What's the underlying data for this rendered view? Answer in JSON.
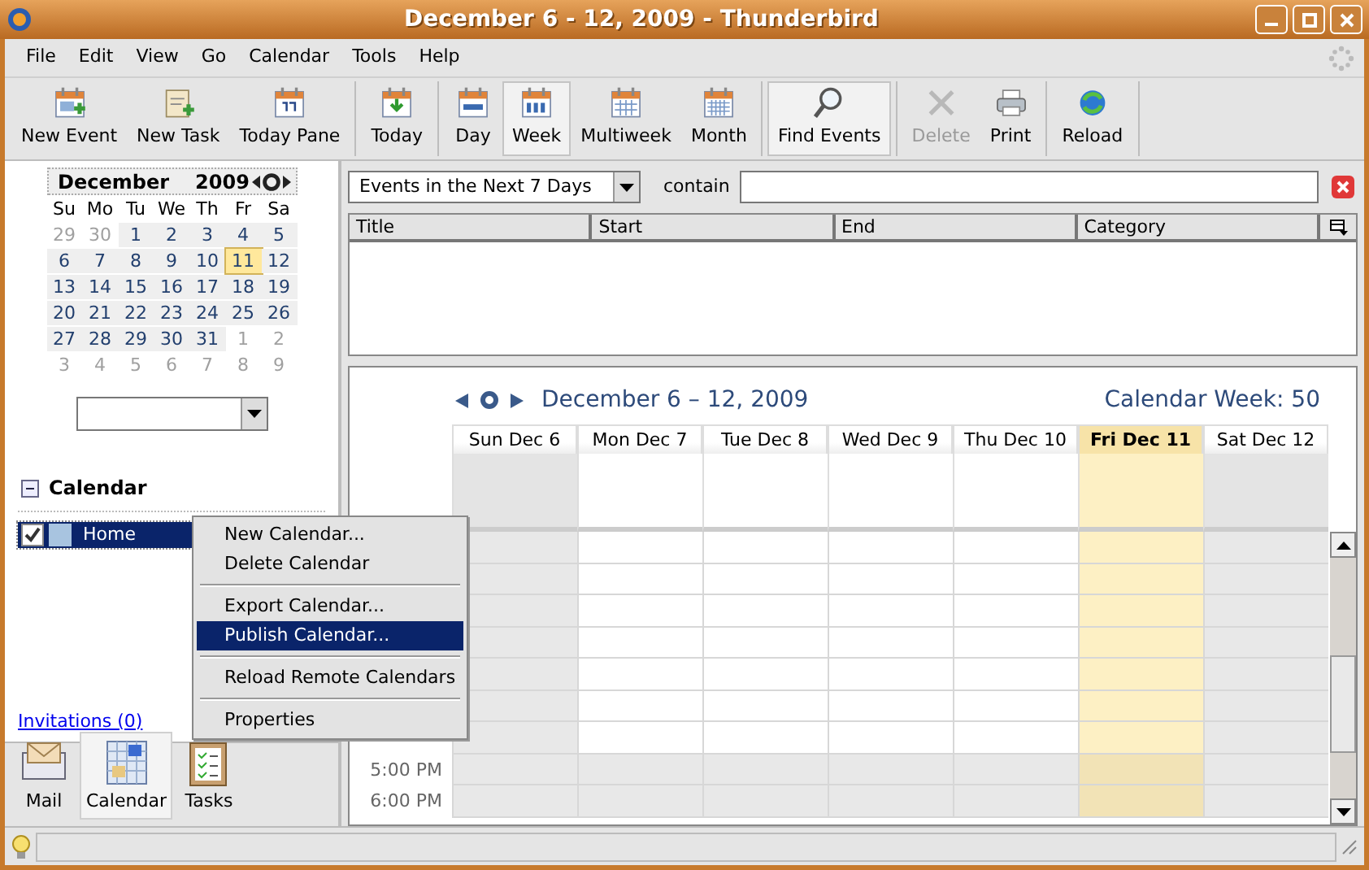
{
  "window": {
    "title": "December 6 - 12, 2009 - Thunderbird"
  },
  "menu_bar": [
    "File",
    "Edit",
    "View",
    "Go",
    "Calendar",
    "Tools",
    "Help"
  ],
  "toolbar": [
    [
      {
        "label": "New Event",
        "selected": false,
        "disabled": false
      },
      {
        "label": "New Task",
        "selected": false,
        "disabled": false
      },
      {
        "label": "Today Pane",
        "selected": false,
        "disabled": false
      }
    ],
    [
      {
        "label": "Today",
        "selected": false,
        "disabled": false
      }
    ],
    [
      {
        "label": "Day",
        "selected": false,
        "disabled": false
      },
      {
        "label": "Week",
        "selected": true,
        "disabled": false
      },
      {
        "label": "Multiweek",
        "selected": false,
        "disabled": false
      },
      {
        "label": "Month",
        "selected": false,
        "disabled": false
      }
    ],
    [
      {
        "label": "Find Events",
        "selected": true,
        "disabled": false
      }
    ],
    [
      {
        "label": "Delete",
        "selected": false,
        "disabled": true
      },
      {
        "label": "Print",
        "selected": false,
        "disabled": false
      }
    ],
    [
      {
        "label": "Reload",
        "selected": false,
        "disabled": false
      }
    ]
  ],
  "mini_month": {
    "month": "December",
    "year": "2009",
    "day_names": [
      "Su",
      "Mo",
      "Tu",
      "We",
      "Th",
      "Fr",
      "Sa"
    ],
    "weeks": [
      [
        {
          "day": "29",
          "other_month": true,
          "selected": false
        },
        {
          "day": "30",
          "other_month": true,
          "selected": false
        },
        {
          "day": "1",
          "other_month": false,
          "selected": false
        },
        {
          "day": "2",
          "other_month": false,
          "selected": false
        },
        {
          "day": "3",
          "other_month": false,
          "selected": false
        },
        {
          "day": "4",
          "other_month": false,
          "selected": false
        },
        {
          "day": "5",
          "other_month": false,
          "selected": false
        }
      ],
      [
        {
          "day": "6",
          "other_month": false,
          "selected": false
        },
        {
          "day": "7",
          "other_month": false,
          "selected": false
        },
        {
          "day": "8",
          "other_month": false,
          "selected": false
        },
        {
          "day": "9",
          "other_month": false,
          "selected": false
        },
        {
          "day": "10",
          "other_month": false,
          "selected": false
        },
        {
          "day": "11",
          "other_month": false,
          "selected": true
        },
        {
          "day": "12",
          "other_month": false,
          "selected": false
        }
      ],
      [
        {
          "day": "13",
          "other_month": false,
          "selected": false
        },
        {
          "day": "14",
          "other_month": false,
          "selected": false
        },
        {
          "day": "15",
          "other_month": false,
          "selected": false
        },
        {
          "day": "16",
          "other_month": false,
          "selected": false
        },
        {
          "day": "17",
          "other_month": false,
          "selected": false
        },
        {
          "day": "18",
          "other_month": false,
          "selected": false
        },
        {
          "day": "19",
          "other_month": false,
          "selected": false
        }
      ],
      [
        {
          "day": "20",
          "other_month": false,
          "selected": false
        },
        {
          "day": "21",
          "other_month": false,
          "selected": false
        },
        {
          "day": "22",
          "other_month": false,
          "selected": false
        },
        {
          "day": "23",
          "other_month": false,
          "selected": false
        },
        {
          "day": "24",
          "other_month": false,
          "selected": false
        },
        {
          "day": "25",
          "other_month": false,
          "selected": false
        },
        {
          "day": "26",
          "other_month": false,
          "selected": false
        }
      ],
      [
        {
          "day": "27",
          "other_month": false,
          "selected": false
        },
        {
          "day": "28",
          "other_month": false,
          "selected": false
        },
        {
          "day": "29",
          "other_month": false,
          "selected": false
        },
        {
          "day": "30",
          "other_month": false,
          "selected": false
        },
        {
          "day": "31",
          "other_month": false,
          "selected": false
        },
        {
          "day": "1",
          "other_month": true,
          "selected": false
        },
        {
          "day": "2",
          "other_month": true,
          "selected": false
        }
      ],
      [
        {
          "day": "3",
          "other_month": true,
          "selected": false
        },
        {
          "day": "4",
          "other_month": true,
          "selected": false
        },
        {
          "day": "5",
          "other_month": true,
          "selected": false
        },
        {
          "day": "6",
          "other_month": true,
          "selected": false
        },
        {
          "day": "7",
          "other_month": true,
          "selected": false
        },
        {
          "day": "8",
          "other_month": true,
          "selected": false
        },
        {
          "day": "9",
          "other_month": true,
          "selected": false
        }
      ]
    ]
  },
  "calendar_section": {
    "title": "Calendar",
    "expanded": true,
    "calendars": [
      {
        "name": "Home",
        "checked": true,
        "selected": true,
        "color": "#a8c4e0"
      }
    ]
  },
  "invitations_link": "Invitations (0)",
  "mode_bar": [
    {
      "label": "Mail",
      "selected": false
    },
    {
      "label": "Calendar",
      "selected": true
    },
    {
      "label": "Tasks",
      "selected": false
    }
  ],
  "search": {
    "filter": "Events in the Next 7 Days",
    "contain_label": "contain"
  },
  "event_list": {
    "columns": [
      "Title",
      "Start",
      "End",
      "Category"
    ]
  },
  "week_view": {
    "title": "December 6 – 12, 2009",
    "week_label": "Calendar Week: 50",
    "days": [
      {
        "label": "Sun Dec 6",
        "today": false,
        "weekend": true
      },
      {
        "label": "Mon Dec 7",
        "today": false,
        "weekend": false
      },
      {
        "label": "Tue Dec 8",
        "today": false,
        "weekend": false
      },
      {
        "label": "Wed Dec 9",
        "today": false,
        "weekend": false
      },
      {
        "label": "Thu Dec 10",
        "today": false,
        "weekend": false
      },
      {
        "label": "Fri Dec 11",
        "today": true,
        "weekend": false
      },
      {
        "label": "Sat Dec 12",
        "today": false,
        "weekend": true
      }
    ],
    "visible_hours": [
      "5:00 PM",
      "6:00 PM"
    ]
  },
  "context_menu": [
    [
      {
        "label": "New Calendar...",
        "selected": false
      },
      {
        "label": "Delete Calendar",
        "selected": false
      }
    ],
    [
      {
        "label": "Export Calendar...",
        "selected": false
      },
      {
        "label": "Publish Calendar...",
        "selected": true
      }
    ],
    [
      {
        "label": "Reload Remote Calendars",
        "selected": false
      }
    ],
    [
      {
        "label": "Properties",
        "selected": false
      }
    ]
  ]
}
